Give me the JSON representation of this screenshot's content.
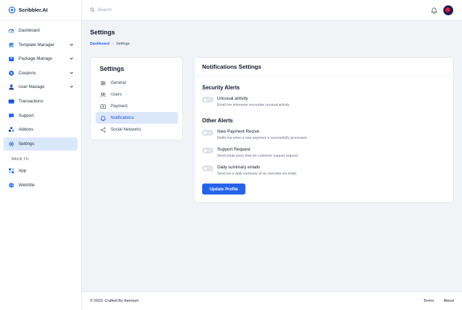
{
  "brand": {
    "name": "Scribbler.AI",
    "accent": "#2563eb"
  },
  "sidebar": {
    "items": [
      {
        "label": "Dashboard",
        "icon": "dashboard-icon",
        "expandable": false,
        "active": false
      },
      {
        "label": "Template Manager",
        "icon": "template-icon",
        "expandable": true,
        "active": false
      },
      {
        "label": "Package Manage",
        "icon": "package-icon",
        "expandable": true,
        "active": false
      },
      {
        "label": "Coupons",
        "icon": "coupon-icon",
        "expandable": true,
        "active": false
      },
      {
        "label": "User Manage",
        "icon": "user-icon",
        "expandable": true,
        "active": false
      },
      {
        "label": "Transactions",
        "icon": "card-icon",
        "expandable": false,
        "active": false
      },
      {
        "label": "Support",
        "icon": "support-icon",
        "expandable": false,
        "active": false
      },
      {
        "label": "Addons",
        "icon": "addons-icon",
        "expandable": false,
        "active": false
      },
      {
        "label": "Settings",
        "icon": "gear-icon",
        "expandable": false,
        "active": true
      }
    ],
    "back_to_label": "BACK TO",
    "back_items": [
      {
        "label": "App",
        "icon": "grid-icon"
      },
      {
        "label": "WebSite",
        "icon": "globe-icon"
      }
    ]
  },
  "topbar": {
    "search_placeholder": "Search"
  },
  "page": {
    "title": "Settings",
    "breadcrumb": {
      "link": "Dashboard",
      "separator": "›",
      "current": "Settings"
    }
  },
  "settings_menu": {
    "title": "Settings",
    "items": [
      {
        "label": "General",
        "icon": "sliders-icon",
        "active": false
      },
      {
        "label": "Users",
        "icon": "users-icon",
        "active": false
      },
      {
        "label": "Payment",
        "icon": "payment-icon",
        "active": false
      },
      {
        "label": "Notifications",
        "icon": "bell-icon",
        "active": true
      },
      {
        "label": "Social Networks",
        "icon": "share-icon",
        "active": false
      }
    ]
  },
  "notifications": {
    "header": "Notifications Settings",
    "security_title": "Security Alerts",
    "security_alerts": [
      {
        "title": "Unusual activity",
        "description": "Email me whenever encounter unusual activity.",
        "enabled": false
      }
    ],
    "other_title": "Other Alerts",
    "other_alerts": [
      {
        "title": "New Payment Recive",
        "description": "Notify me when a new payment is successfully processed.",
        "enabled": false
      },
      {
        "title": "Support Request",
        "description": "Send email every time for customer support request.",
        "enabled": false
      },
      {
        "title": "Daily summary emails",
        "description": "Send me a daily summary of an overview via email.",
        "enabled": false
      }
    ],
    "button_label": "Update Profile"
  },
  "footer": {
    "copyright": "© 2023. Crafted By themeyn",
    "links": [
      "Terms",
      "About"
    ]
  }
}
